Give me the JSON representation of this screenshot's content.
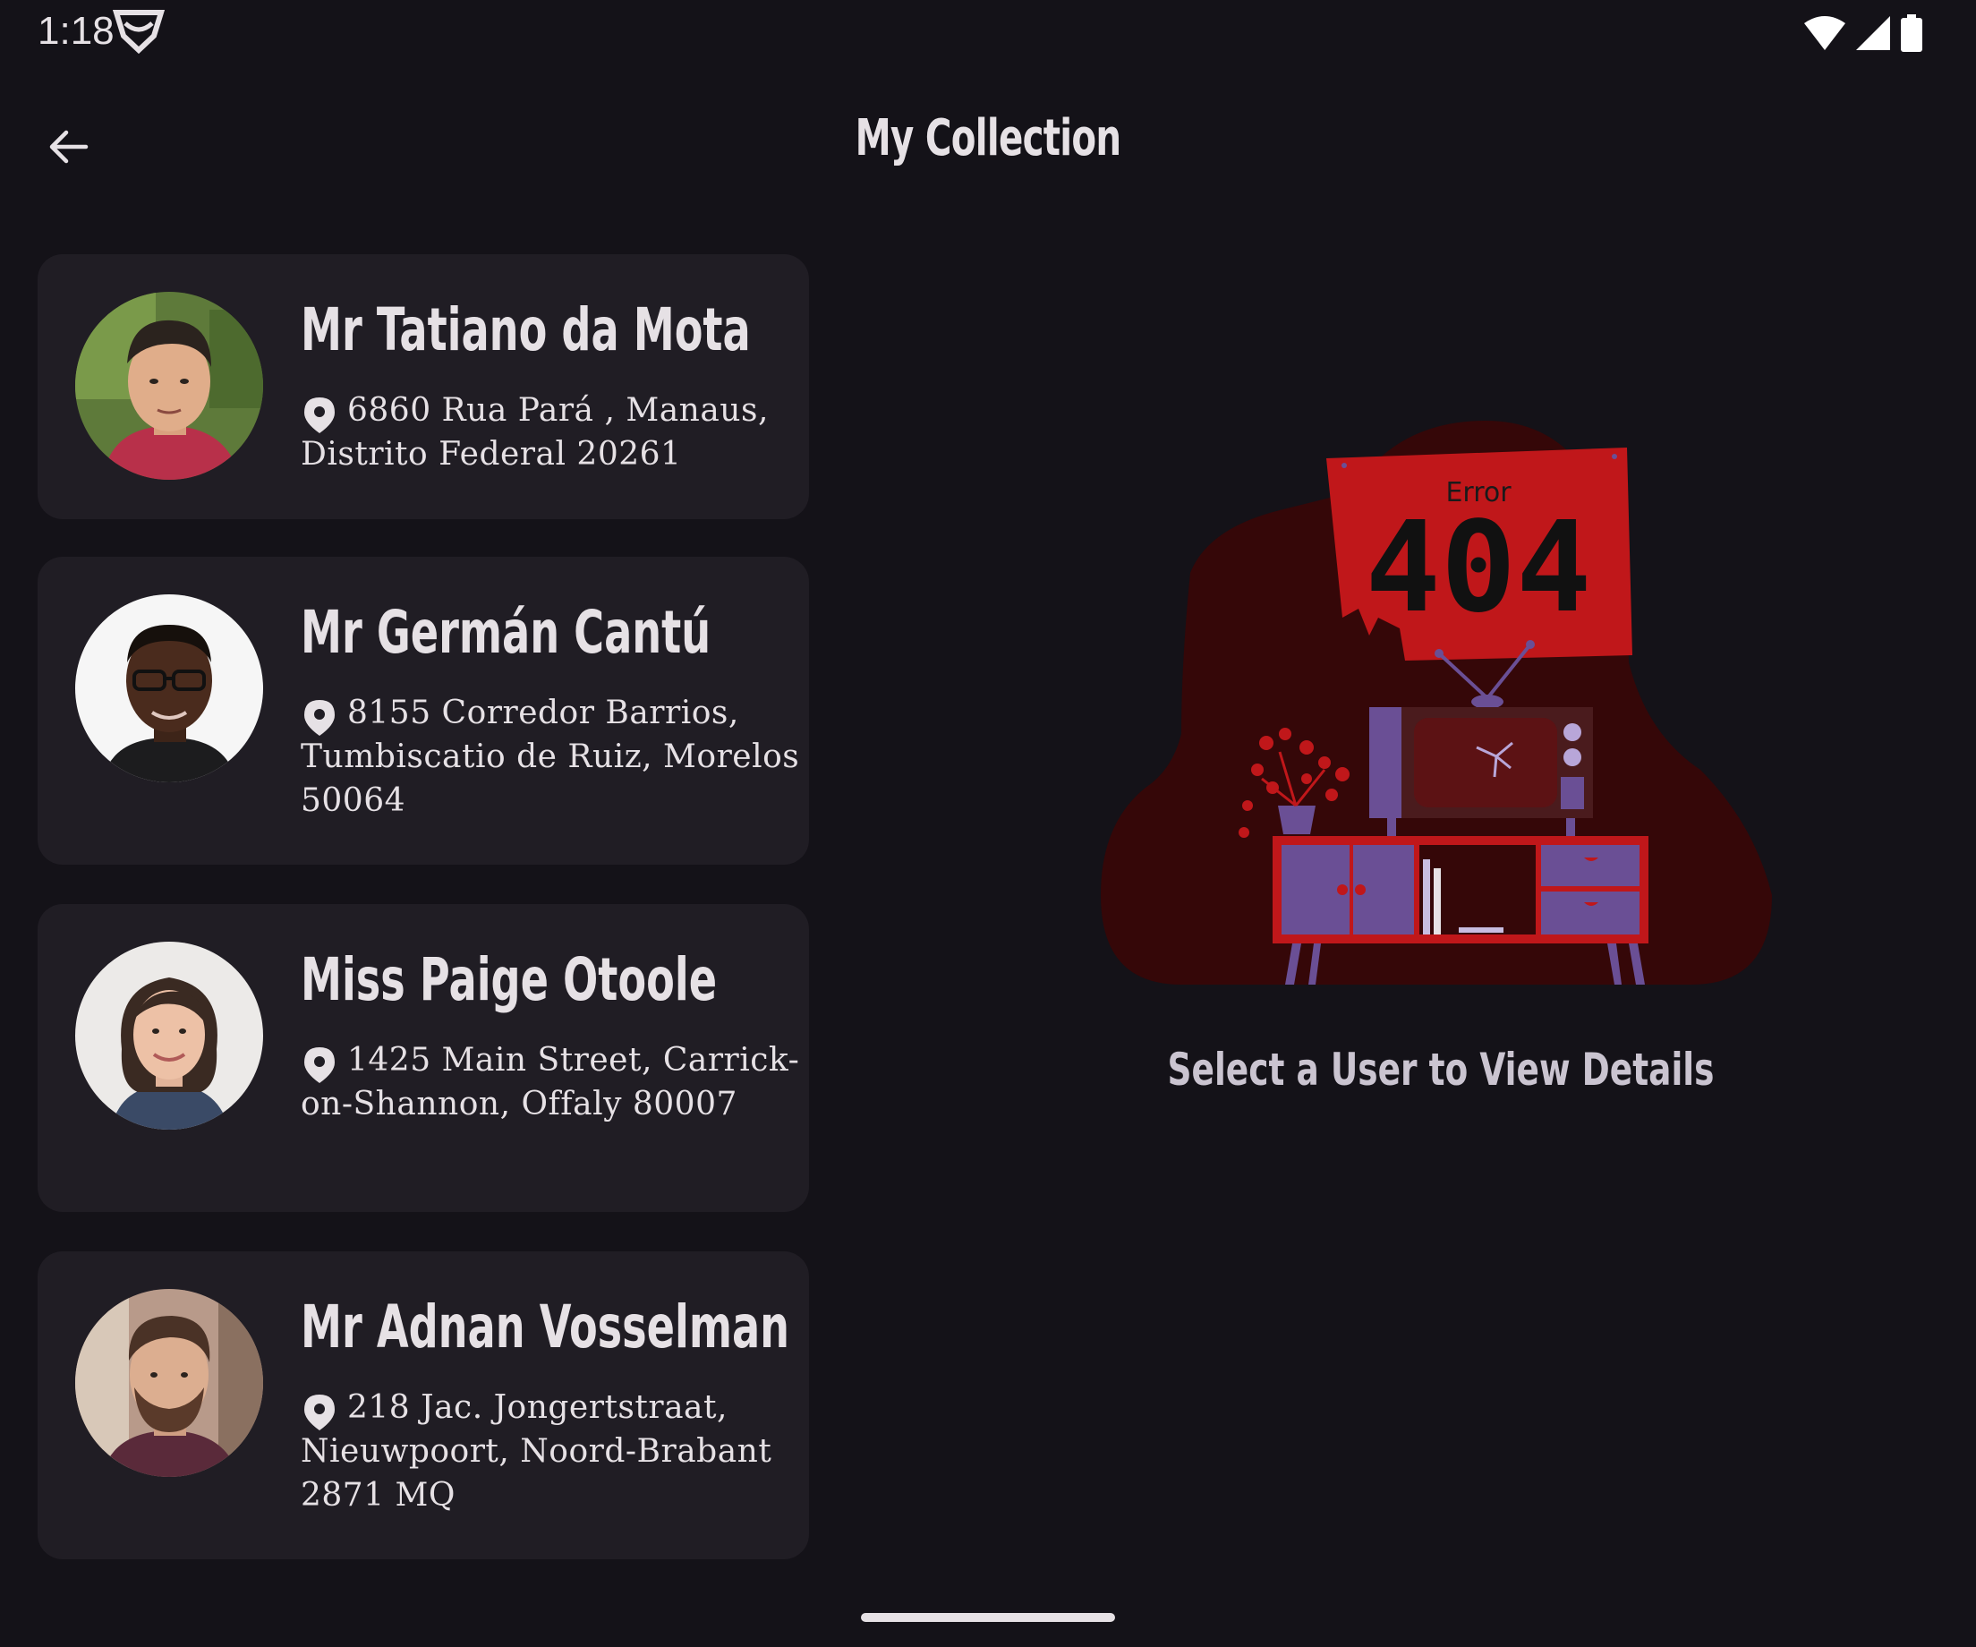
{
  "status_bar": {
    "time": "1:18",
    "icons": [
      "app-notification-icon",
      "wifi-icon",
      "cellular-signal-icon",
      "battery-icon"
    ]
  },
  "app_bar": {
    "title": "My Collection",
    "back_icon": "arrow-back-icon"
  },
  "users": [
    {
      "name": "Mr Tatiano da Mota",
      "address": "6860 Rua Pará , Manaus, Distrito Federal 20261"
    },
    {
      "name": "Mr Germán Cantú",
      "address": "8155 Corredor Barrios, Tumbiscatio de Ruiz, Morelos 50064"
    },
    {
      "name": "Miss Paige Otoole",
      "address": "1425 Main Street, Carrick-on-Shannon, Offaly 80007"
    },
    {
      "name": "Mr Adnan Vosselman",
      "address": "218 Jac. Jongertstraat, Nieuwpoort, Noord-Brabant 2871 MQ"
    }
  ],
  "detail": {
    "error_label": "Error",
    "error_code": "404",
    "message": "Select a User to View Details"
  },
  "colors": {
    "background": "#141218",
    "card": "#201d24",
    "accent_red": "#c0171a",
    "blob": "#350708",
    "furniture_purple": "#6a4f95"
  }
}
